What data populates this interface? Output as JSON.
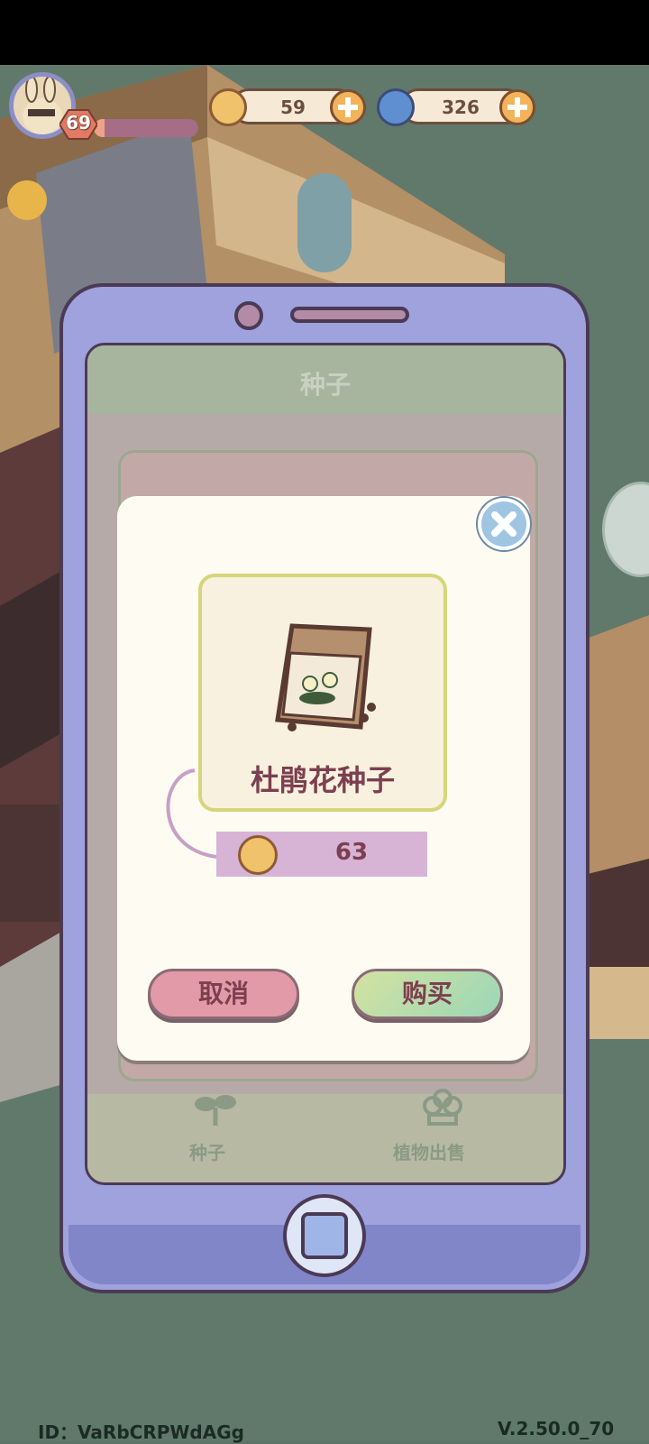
{
  "hud": {
    "level": "69",
    "xp_progress": 0.1,
    "coins": "59",
    "gems": "326"
  },
  "screen": {
    "title": "种子",
    "tabs": [
      {
        "label": "种子"
      },
      {
        "label": "植物出售"
      }
    ]
  },
  "dialog": {
    "item_name": "杜鹃花种子",
    "price": "63",
    "cancel_label": "取消",
    "buy_label": "购买"
  },
  "footer": {
    "id_text": "ID：VaRbCRPWdAGg",
    "version": "V.2.50.0_70"
  },
  "icons": [
    "coin-icon",
    "swirl-gem-icon",
    "plus-icon",
    "close-icon",
    "seed-packet-icon",
    "sprout-icon",
    "flower-icon",
    "home-icon"
  ],
  "colors": {
    "dialog_bg": "#fefbf2",
    "item_name": "#7d3f4f",
    "price_tag": "#d7b4d6",
    "phone_body": "#9fa2dd"
  }
}
